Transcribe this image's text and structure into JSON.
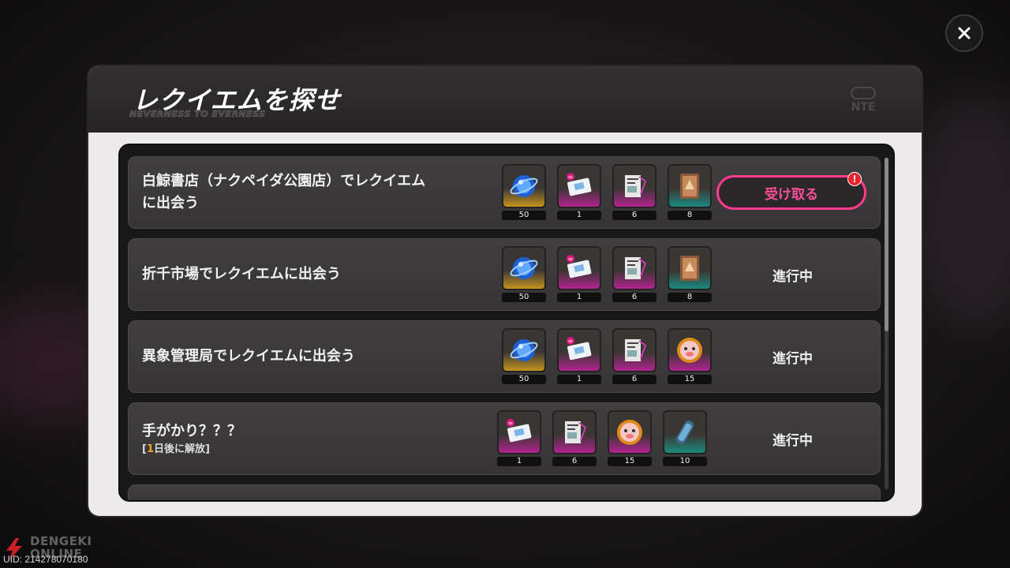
{
  "panel": {
    "title": "レクイエムを探せ",
    "subtitle": "NEVERNESS TO EVERNESS",
    "brand": "NTE"
  },
  "quests": [
    {
      "title_lines": [
        "白鯨書店（ナクペイダ公園店）でレクイエム",
        "に出会う"
      ],
      "rewards": [
        {
          "icon": "blue-orb-icon",
          "rarity": "gold",
          "qty": "50"
        },
        {
          "icon": "ticket-card-icon",
          "rarity": "magenta",
          "qty": "1"
        },
        {
          "icon": "document-card-icon",
          "rarity": "magenta",
          "qty": "6"
        },
        {
          "icon": "bronze-badge-icon",
          "rarity": "teal",
          "qty": "8"
        }
      ],
      "action": "受け取る",
      "has_alert": true,
      "alert": "!"
    },
    {
      "title_lines": [
        "折千市場でレクイエムに出会う"
      ],
      "rewards": [
        {
          "icon": "blue-orb-icon",
          "rarity": "gold",
          "qty": "50"
        },
        {
          "icon": "ticket-card-icon",
          "rarity": "magenta",
          "qty": "1"
        },
        {
          "icon": "document-card-icon",
          "rarity": "magenta",
          "qty": "6"
        },
        {
          "icon": "bronze-badge-icon",
          "rarity": "teal",
          "qty": "8"
        }
      ],
      "status": "進行中"
    },
    {
      "title_lines": [
        "異象管理局でレクイエムに出会う"
      ],
      "rewards": [
        {
          "icon": "blue-orb-icon",
          "rarity": "gold",
          "qty": "50"
        },
        {
          "icon": "ticket-card-icon",
          "rarity": "magenta",
          "qty": "1"
        },
        {
          "icon": "document-card-icon",
          "rarity": "magenta",
          "qty": "6"
        },
        {
          "icon": "pig-coin-icon",
          "rarity": "magenta",
          "qty": "15"
        }
      ],
      "status": "進行中"
    },
    {
      "title_lines": [
        "手がかり？？？"
      ],
      "unlock_prefix": "[",
      "unlock_num": "1",
      "unlock_suffix": "日後に解放]",
      "rewards": [
        {
          "icon": "ticket-card-icon",
          "rarity": "magenta",
          "qty": "1"
        },
        {
          "icon": "document-card-icon",
          "rarity": "magenta",
          "qty": "6"
        },
        {
          "icon": "pig-coin-icon",
          "rarity": "magenta",
          "qty": "15"
        },
        {
          "icon": "canister-icon",
          "rarity": "teal",
          "qty": "10"
        }
      ],
      "status": "進行中"
    }
  ],
  "watermark": {
    "line1": "DENGEKI",
    "line2": "ONLINE"
  },
  "uid": "UID: 214278070180"
}
